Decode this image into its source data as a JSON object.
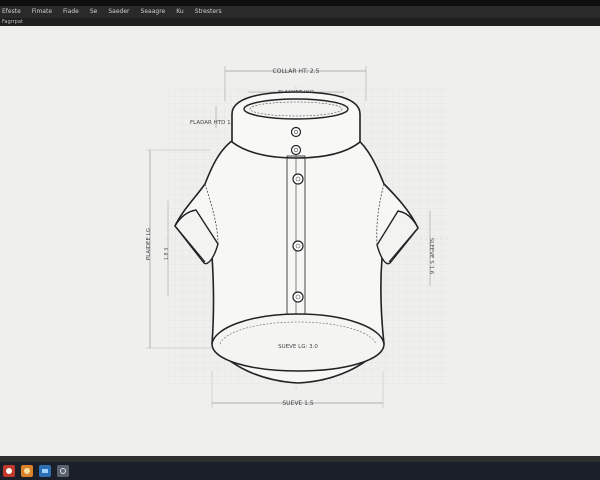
{
  "menu": {
    "items": [
      "Efeste",
      "Fimate",
      "Fiade",
      "Se",
      "Saeder",
      "Seaagre",
      "Ku",
      "Stresters"
    ]
  },
  "subbar": {
    "label": "Fagrrpat"
  },
  "drawing": {
    "collar_height_label": "COLLAR HT: 2.5",
    "placket_width_label": "FLACKET WO",
    "placket_height_label": "FLADAR HTD 1.2",
    "body_length_label": "PLAIDEE LG",
    "body_value_label": "1.8 3",
    "sleeve_height_label": "SLEEVE S 1.6",
    "sleeve_length_label": "SUEVE LG: 3.0",
    "sleeve_width_label": "SUEVE 1.5"
  },
  "taskbar": {
    "icons": [
      "start-icon",
      "browser-icon",
      "folder-icon",
      "app-icon"
    ]
  },
  "colors": {
    "canvas_bg": "#efefee",
    "line": "#2a2a2a",
    "dim": "#7a7a7a",
    "grid": "#d9d9d9"
  }
}
